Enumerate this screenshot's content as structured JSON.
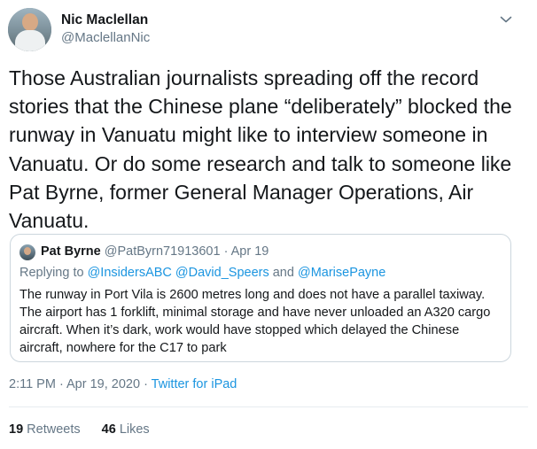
{
  "author": {
    "name": "Nic Maclellan",
    "handle": "@MaclellanNic"
  },
  "tweet": {
    "text": "Those Australian journalists spreading off the record stories that the Chinese plane “deliberately” blocked the runway in Vanuatu might like to interview someone in Vanuatu. Or do some research and talk to someone like Pat Byrne, former General Manager Operations, Air Vanuatu."
  },
  "quoted": {
    "name": "Pat Byrne",
    "handle": "@PatByrn71913601",
    "separator": " · ",
    "date": "Apr 19",
    "replying_prefix": "Replying to ",
    "replying_users": "@InsidersABC @David_Speers",
    "replying_and": " and ",
    "replying_last": "@MarisePayne",
    "text": "The runway in Port Vila is 2600 metres long and does not have a parallel taxiway. The airport has 1 forklift, minimal storage and have never unloaded an A320 cargo aircraft. When it’s dark, work would have stopped which delayed the Chinese aircraft, nowhere for the C17 to park"
  },
  "meta": {
    "timestamp": "2:11 PM · Apr 19, 2020 · ",
    "source": "Twitter for iPad"
  },
  "stats": {
    "retweets_count": "19",
    "retweets_label": " Retweets",
    "likes_count": "46",
    "likes_label": " Likes"
  },
  "icons": {
    "menu": "chevron-down-icon"
  },
  "colors": {
    "link": "#1b95e0",
    "secondary_text": "#657786",
    "primary_text": "#14171a",
    "border": "#ccd6dd"
  }
}
